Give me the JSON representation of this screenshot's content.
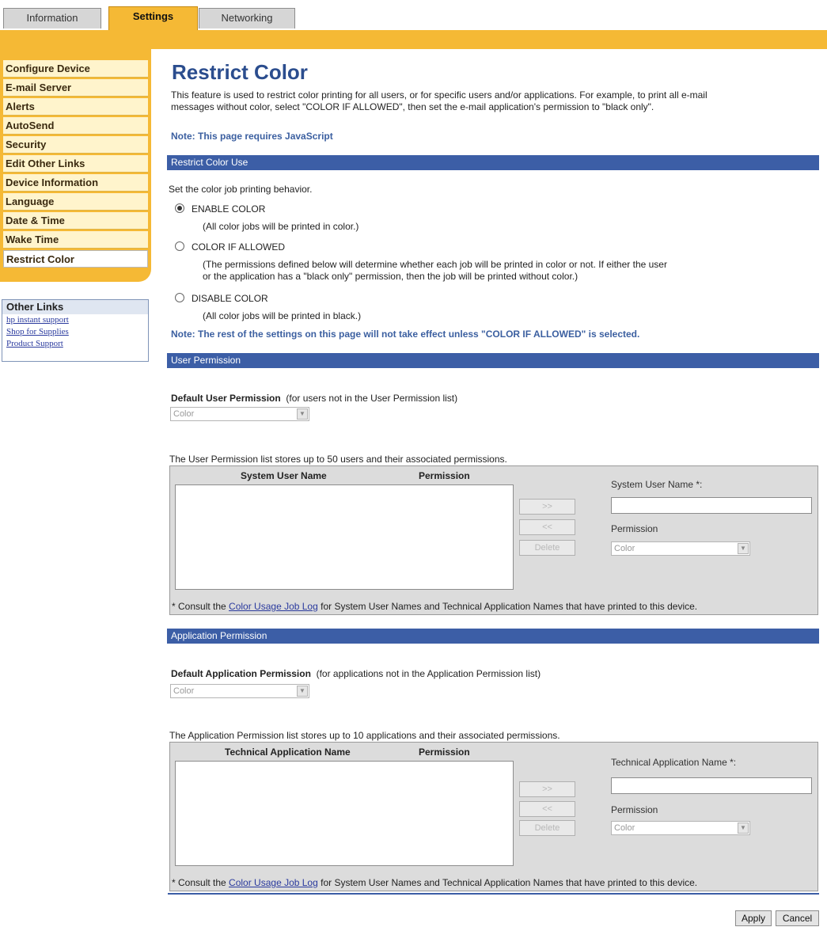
{
  "tabs": [
    {
      "label": "Information"
    },
    {
      "label": "Settings"
    },
    {
      "label": "Networking"
    }
  ],
  "sidebar": {
    "items": [
      {
        "label": "Configure Device"
      },
      {
        "label": "E-mail Server"
      },
      {
        "label": "Alerts"
      },
      {
        "label": "AutoSend"
      },
      {
        "label": "Security"
      },
      {
        "label": "Edit Other Links"
      },
      {
        "label": "Device Information"
      },
      {
        "label": "Language"
      },
      {
        "label": "Date & Time"
      },
      {
        "label": "Wake Time"
      },
      {
        "label": "Restrict Color"
      }
    ],
    "other_links": {
      "header": "Other Links",
      "links": [
        "hp instant support",
        "Shop for Supplies",
        "Product Support"
      ]
    }
  },
  "page": {
    "title": "Restrict Color",
    "intro_line1": "This feature is used to restrict color printing for all users, or for specific users and/or applications. For example, to print all e-mail",
    "intro_line2": "messages without color, select \"COLOR IF ALLOWED\", then set the e-mail application's permission to \"black only\".",
    "js_note": "Note: This page requires JavaScript"
  },
  "restrict_section": {
    "header": "Restrict Color Use",
    "instruction": "Set the color job printing behavior.",
    "options": [
      {
        "label": "ENABLE COLOR",
        "desc1": "(All color jobs will be printed in color.)",
        "desc2": "",
        "selected": true
      },
      {
        "label": "COLOR IF ALLOWED",
        "desc1": "(The permissions defined below will determine whether each job will be printed in color or not. If either the user",
        "desc2": "or the application has a \"black only\" permission, then the job will be printed without color.)",
        "selected": false
      },
      {
        "label": "DISABLE COLOR",
        "desc1": "(All color jobs will be printed in black.)",
        "desc2": "",
        "selected": false
      }
    ],
    "note": "Note: The rest of the settings on this page will not take effect unless \"COLOR IF ALLOWED\" is selected."
  },
  "user_section": {
    "header": "User Permission",
    "default_label": "Default User Permission",
    "default_hint": "(for users not in the User Permission list)",
    "default_value": "Color",
    "list_info": "The User Permission list stores up to 50 users and their associated permissions.",
    "col_name": "System User Name",
    "col_permission": "Permission",
    "btn_add": ">>",
    "btn_remove": "<<",
    "btn_delete": "Delete",
    "name_label": "System User Name *:",
    "permission_label": "Permission",
    "permission_value": "Color",
    "footnote_prefix": "* Consult the ",
    "footnote_link": "Color Usage Job Log",
    "footnote_suffix": " for System User Names and Technical Application Names that have printed to this device."
  },
  "app_section": {
    "header": "Application Permission",
    "default_label": "Default Application Permission",
    "default_hint": "(for applications not in the Application Permission list)",
    "default_value": "Color",
    "list_info": "The Application Permission list stores up to 10 applications and their associated permissions.",
    "col_name": "Technical Application Name",
    "col_permission": "Permission",
    "btn_add": ">>",
    "btn_remove": "<<",
    "btn_delete": "Delete",
    "name_label": "Technical Application Name *:",
    "permission_label": "Permission",
    "permission_value": "Color",
    "footnote_prefix": "* Consult the ",
    "footnote_link": "Color Usage Job Log",
    "footnote_suffix": " for System User Names and Technical Application Names that have printed to this device."
  },
  "actions": {
    "apply": "Apply",
    "cancel": "Cancel"
  },
  "colors": {
    "accent_gold": "#f5b935",
    "section_blue": "#3c5ea6",
    "title_blue": "#2b4d8e"
  }
}
